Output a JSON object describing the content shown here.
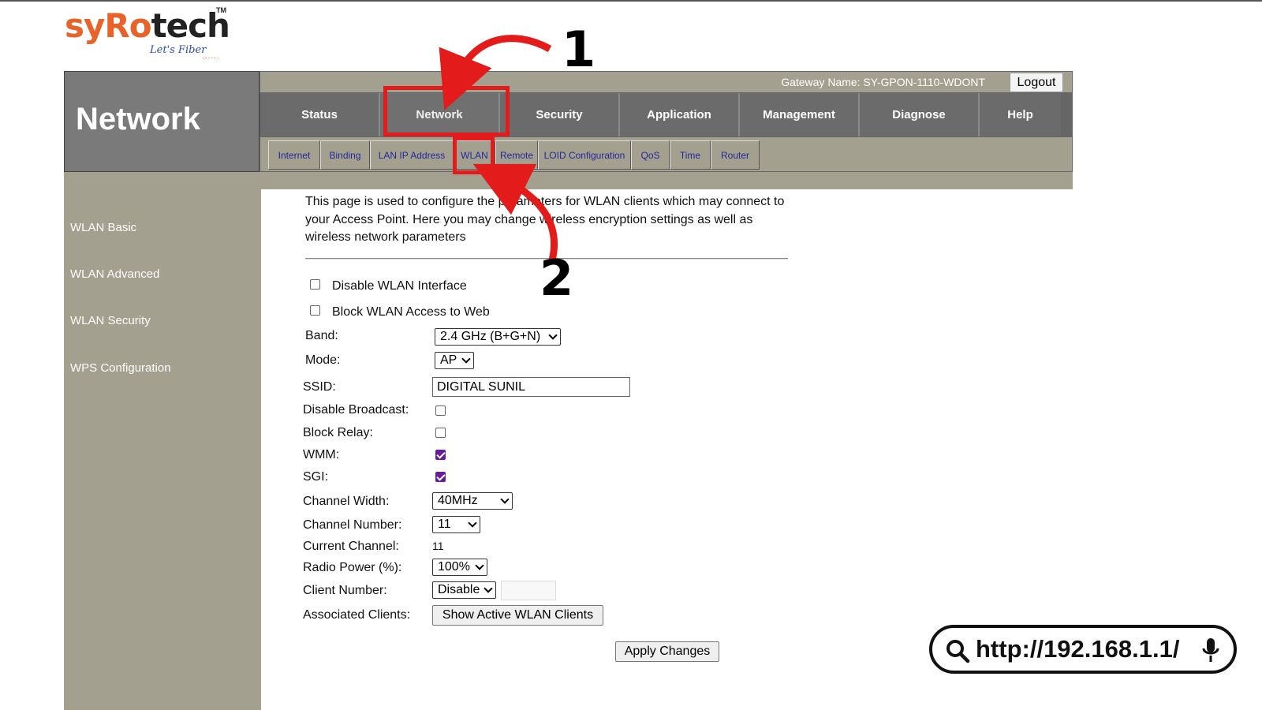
{
  "logo": {
    "brand_left": "syRo",
    "brand_right": "tech",
    "trademark": "TM",
    "tagline": "Let's Fiber",
    "dots": "......"
  },
  "header": {
    "title": "Network",
    "gateway_label": "Gateway Name: SY-GPON-1110-WDONT",
    "logout_label": "Logout"
  },
  "nav": {
    "tabs": [
      "Status",
      "Network",
      "Security",
      "Application",
      "Management",
      "Diagnose",
      "Help"
    ],
    "active_tab": "Network",
    "subtabs": [
      "Internet",
      "Binding",
      "LAN IP Address",
      "WLAN",
      "Remote",
      "LOID Configuration",
      "QoS",
      "Time",
      "Router"
    ],
    "active_subtab": "WLAN"
  },
  "sidebar": {
    "items": [
      "WLAN Basic",
      "WLAN Advanced",
      "WLAN Security",
      "WPS Configuration"
    ]
  },
  "content": {
    "description": "This page is used to configure the parameters for WLAN clients which may connect to your Access Point. Here you may change wireless encryption settings as well as wireless network parameters",
    "disable_wlan_label": "Disable WLAN Interface",
    "disable_wlan_checked": false,
    "block_wlan_label": "Block WLAN Access to Web",
    "block_wlan_checked": false,
    "band_label": "Band:",
    "band_value": "2.4 GHz (B+G+N)",
    "mode_label": "Mode:",
    "mode_value": "AP",
    "ssid_label": "SSID:",
    "ssid_value": "DIGITAL SUNIL",
    "disable_broadcast_label": "Disable Broadcast:",
    "disable_broadcast_checked": false,
    "block_relay_label": "Block Relay:",
    "block_relay_checked": false,
    "wmm_label": "WMM:",
    "wmm_checked": true,
    "sgi_label": "SGI:",
    "sgi_checked": true,
    "channel_width_label": "Channel Width:",
    "channel_width_value": "40MHz",
    "channel_number_label": "Channel Number:",
    "channel_number_value": "11",
    "current_channel_label": "Current Channel:",
    "current_channel_value": "11",
    "radio_power_label": "Radio Power (%):",
    "radio_power_value": "100%",
    "client_number_label": "Client Number:",
    "client_number_value": "Disable",
    "associated_clients_label": "Associated Clients:",
    "show_clients_button": "Show Active WLAN Clients",
    "apply_button": "Apply Changes"
  },
  "annotations": {
    "step1": "1",
    "step2": "2",
    "highlight_color": "#e41b1b"
  },
  "urlbar": {
    "url": "http://192.168.1.1/"
  },
  "colors": {
    "panel": "#a3a08f",
    "nav": "#6b6b6b",
    "link": "#24279b",
    "check": "#6a1b9a"
  }
}
